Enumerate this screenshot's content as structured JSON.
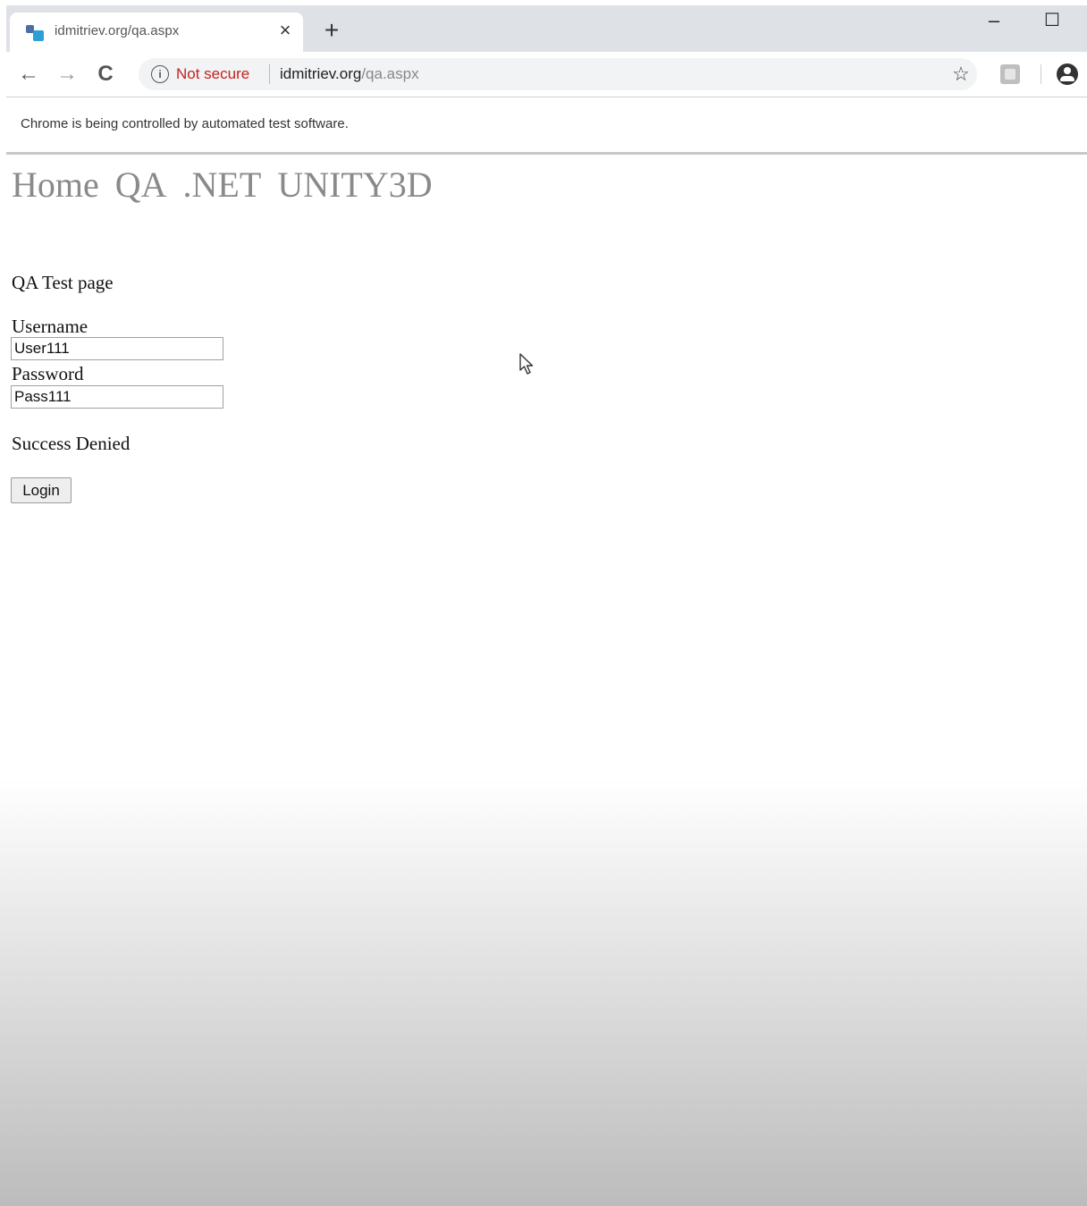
{
  "browser": {
    "tab": {
      "title": "idmitriev.org/qa.aspx",
      "close_glyph": "×"
    },
    "new_tab_glyph": "+",
    "window_controls": {
      "minimize": "–",
      "maximize": "☐"
    },
    "toolbar": {
      "back_glyph": "←",
      "forward_glyph": "→",
      "reload_glyph": "C",
      "security_label": "Not secure",
      "url_host": "idmitriev.org",
      "url_path": "/qa.aspx",
      "star_glyph": "☆"
    },
    "infobar_text": "Chrome is being controlled by automated test software."
  },
  "page": {
    "nav": [
      "Home",
      "QA",
      ".NET",
      "UNITY3D"
    ],
    "title": "QA Test page",
    "username_label": "Username",
    "username_value": "User111",
    "password_label": "Password",
    "password_value": "Pass111",
    "status_text": "Success Denied",
    "login_label": "Login"
  },
  "colors": {
    "tab_strip": "#dee1e6",
    "not_secure": "#c5221f",
    "nav_link": "#8a8a8a"
  }
}
